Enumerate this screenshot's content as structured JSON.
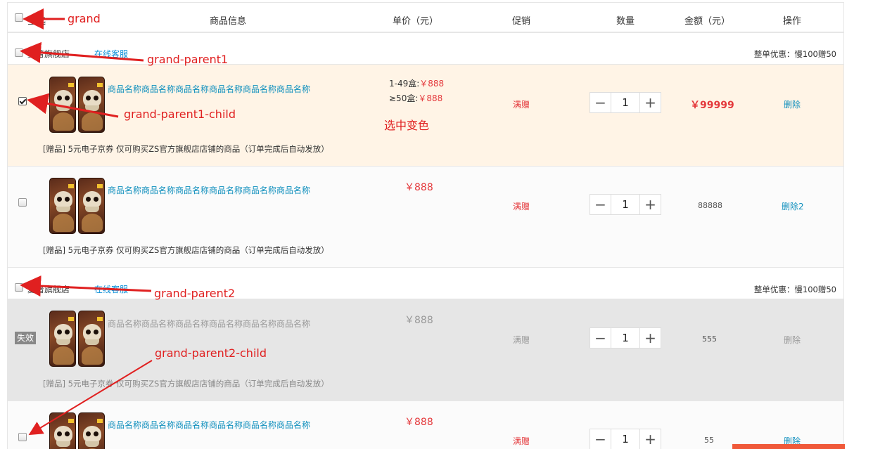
{
  "header": {
    "select_all": "全选",
    "product_info": "商品信息",
    "unit_price": "单价（元）",
    "promotion": "促销",
    "quantity": "数量",
    "amount": "金额（元）",
    "operation": "操作"
  },
  "shops": [
    {
      "name": "夏普旗舰店",
      "customer_service": "在线客服",
      "promo_note": "整单优惠：慢100赠50",
      "items": [
        {
          "name": "商品名称商品名称商品名称商品名称商品名称商品名称",
          "gift": "[赠品] 5元电子京券 仅可购买ZS官方旗舰店店铺的商品（订单完成后自动发放）",
          "tier1_label": "1-49盒:",
          "tier1_price": "￥888",
          "tier2_label": "≥50盒:",
          "tier2_price": "￥888",
          "promotion": "满赠",
          "quantity": "1",
          "amount": "￥99999",
          "operation": "删除",
          "checked": true
        },
        {
          "name": "商品名称商品名称商品名称商品名称商品名称商品名称",
          "gift": "[赠品] 5元电子京券 仅可购买ZS官方旗舰店店铺的商品（订单完成后自动发放）",
          "price": "￥888",
          "promotion": "满赠",
          "quantity": "1",
          "amount": "88888",
          "operation": "删除2",
          "checked": false
        }
      ]
    },
    {
      "name": "夏普旗舰店",
      "customer_service": "在线客服",
      "promo_note": "整单优惠：慢100赠50",
      "items": [
        {
          "invalid_tag": "失效",
          "name": "商品名称商品名称商品名称商品名称商品名称商品名称",
          "gift": "[赠品] 5元电子京券 仅可购买ZS官方旗舰店店铺的商品（订单完成后自动发放）",
          "price": "￥888",
          "promotion": "满赠",
          "quantity": "1",
          "amount": "555",
          "operation": "删除"
        },
        {
          "name": "商品名称商品名称商品名称商品名称商品名称商品名称",
          "price": "￥888",
          "promotion": "满赠",
          "quantity": "1",
          "amount": "55",
          "operation": "删除",
          "checked": false
        }
      ]
    }
  ],
  "qty_controls": {
    "minus": "−",
    "plus": "+"
  },
  "annotations": {
    "grand": "grand",
    "grand_parent1": "grand-parent1",
    "grand_parent1_child": "grand-parent1-child",
    "selected_color_change": "选中变色",
    "grand_parent2": "grand-parent2",
    "grand_parent2_child": "grand-parent2-child"
  },
  "colors": {
    "selected_row_bg": "#fff4e6",
    "normal_row_bg": "#fbfbfb",
    "invalid_row_bg": "#e6e6e6",
    "price_red": "#e4393c",
    "link_blue": "#0f8fbd",
    "annotation_red": "#e02020"
  }
}
